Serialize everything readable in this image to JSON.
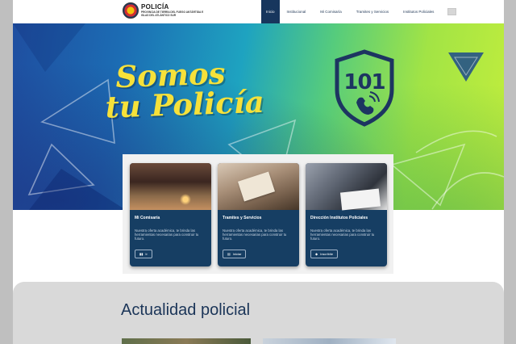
{
  "header": {
    "logo_title": "POLICÍA",
    "logo_subtitle": "PROVINCIA DE TIERRA DEL FUEGO ANTÁRTIDA E ISLAS DEL ATLÁNTICO SUR",
    "nav": [
      "Inicio",
      "Institucional",
      "Mi Comisaría",
      "Tramites y Servicios",
      "Institutos Policiales"
    ],
    "nav_active": "Inicio"
  },
  "hero": {
    "headline_line1": "Somos",
    "headline_line2": "tu Policía",
    "emergency_number": "101"
  },
  "cards": [
    {
      "title": "Mi Comisaría",
      "description": "Nuestra oferta académica, te brinda las herramientas necesarias para construir tu futuro.",
      "button_label": "Ir",
      "button_icon": "building-icon"
    },
    {
      "title": "Tramites y Servicios",
      "description": "Nuestra oferta académica, te brinda las herramientas necesarias para construir tu futuro.",
      "button_label": "Iniciar",
      "button_icon": "form-icon"
    },
    {
      "title": "Dirección Institutos Policiales",
      "description": "Nuestra oferta académica, te brinda las herramientas necesarias para construir tu futuro.",
      "button_label": "Inscribite",
      "button_icon": "graduation-cap-icon"
    }
  ],
  "news": {
    "title": "Actualidad policial"
  },
  "colors": {
    "navy": "#17365d",
    "card": "#163e63",
    "headline_yellow": "#f6e13a"
  }
}
